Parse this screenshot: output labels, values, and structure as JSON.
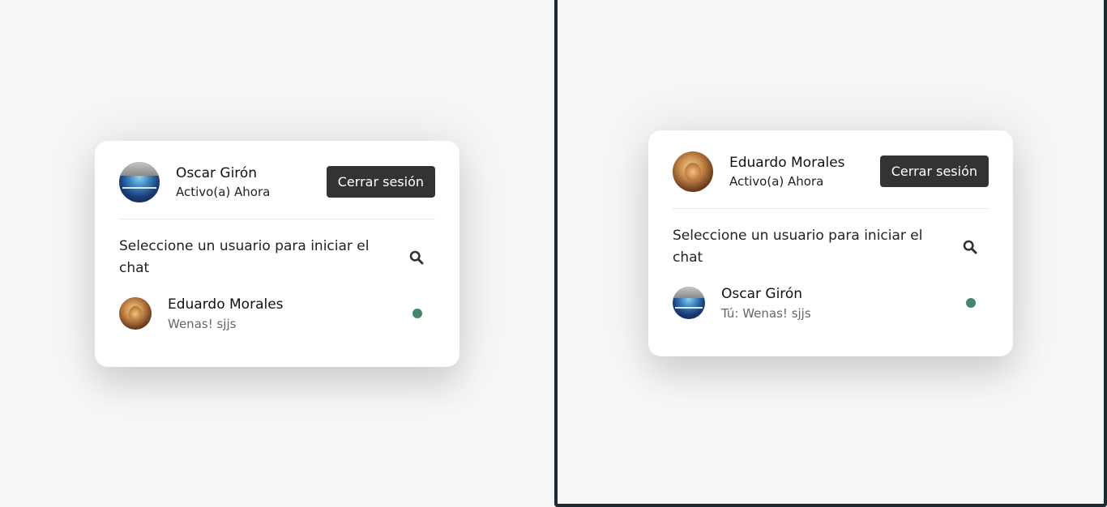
{
  "left_pane": {
    "header": {
      "name": "Oscar Girón",
      "status": "Activo(a) Ahora",
      "logout_label": "Cerrar sesión",
      "avatar_icon": "user-photo-oscar"
    },
    "search": {
      "prompt": "Seleccione un usuario para iniciar el chat",
      "icon": "search-icon"
    },
    "users": [
      {
        "name": "Eduardo Morales",
        "message": "Wenas! sjjs",
        "status": "online",
        "status_color": "#468669",
        "avatar_icon": "user-photo-eduardo"
      }
    ]
  },
  "right_pane": {
    "header": {
      "name": "Eduardo Morales",
      "status": "Activo(a) Ahora",
      "logout_label": "Cerrar sesión",
      "avatar_icon": "user-photo-eduardo"
    },
    "search": {
      "prompt": "Seleccione un usuario para iniciar el chat",
      "icon": "search-icon"
    },
    "users": [
      {
        "name": "Oscar Girón",
        "message": "Tú: Wenas! sjjs",
        "status": "online",
        "status_color": "#468669",
        "avatar_icon": "user-photo-oscar"
      }
    ]
  },
  "colors": {
    "button_bg": "#333333",
    "card_bg": "#ffffff",
    "page_bg": "#f6f6f6",
    "online": "#468669"
  }
}
